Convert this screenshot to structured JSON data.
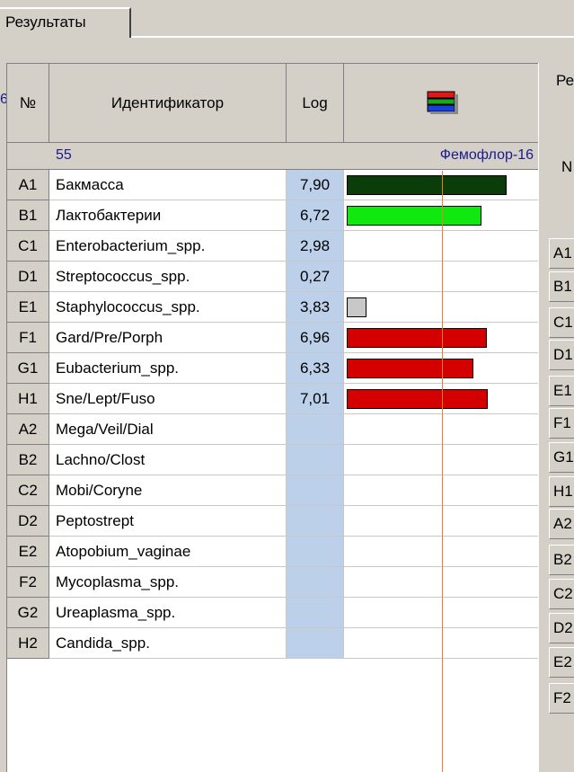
{
  "tab": {
    "label": "Результаты"
  },
  "left_fragment": "6",
  "columns": {
    "num": "№",
    "identifier": "Идентификатор",
    "log": "Log"
  },
  "subheader": {
    "sample": "55",
    "kit": "Фемофлор-16"
  },
  "rows": [
    {
      "id": "A1",
      "name": "Бакмасса",
      "log": "7,90",
      "level": 7.9,
      "color": "#0a3d0a"
    },
    {
      "id": "B1",
      "name": "Лактобактерии",
      "log": "6,72",
      "level": 6.72,
      "color": "#10e810"
    },
    {
      "id": "C1",
      "name": "Enterobacterium_spp.",
      "log": "2,98",
      "level": null,
      "color": ""
    },
    {
      "id": "D1",
      "name": "Streptococcus_spp.",
      "log": "0,27",
      "level": null,
      "color": ""
    },
    {
      "id": "E1",
      "name": "Staphylococcus_spp.",
      "log": "3,83",
      "level": 3.83,
      "color": "#c8c8c8"
    },
    {
      "id": "F1",
      "name": "Gard/Pre/Porph",
      "log": "6,96",
      "level": 6.96,
      "color": "#d40000"
    },
    {
      "id": "G1",
      "name": "Eubacterium_spp.",
      "log": "6,33",
      "level": 6.33,
      "color": "#d40000"
    },
    {
      "id": "H1",
      "name": "Sne/Lept/Fuso",
      "log": "7,01",
      "level": 7.01,
      "color": "#d40000"
    },
    {
      "id": "A2",
      "name": "Mega/Veil/Dial",
      "log": "",
      "level": null,
      "color": ""
    },
    {
      "id": "B2",
      "name": "Lachno/Clost",
      "log": "",
      "level": null,
      "color": ""
    },
    {
      "id": "C2",
      "name": "Mobi/Coryne",
      "log": "",
      "level": null,
      "color": ""
    },
    {
      "id": "D2",
      "name": "Peptostrept",
      "log": "",
      "level": null,
      "color": ""
    },
    {
      "id": "E2",
      "name": "Atopobium_vaginae",
      "log": "",
      "level": null,
      "color": ""
    },
    {
      "id": "F2",
      "name": "Mycoplasma_spp.",
      "log": "",
      "level": null,
      "color": ""
    },
    {
      "id": "G2",
      "name": "Ureaplasma_spp.",
      "log": "",
      "level": null,
      "color": ""
    },
    {
      "id": "H2",
      "name": "Candida_spp.",
      "log": "",
      "level": null,
      "color": ""
    }
  ],
  "right_panel": {
    "title_fragment": "Ре",
    "header_fragment": "N",
    "cells": [
      "A1",
      "B1",
      "C1",
      "D1",
      "E1",
      "F1",
      "G1",
      "H1",
      "A2",
      "B2",
      "C2",
      "D2",
      "E2",
      "F2"
    ]
  },
  "colors": {
    "log_column": "#bcd0ea",
    "reference_line": "#f07a2a",
    "subheader_text": "#1a1a8c"
  }
}
